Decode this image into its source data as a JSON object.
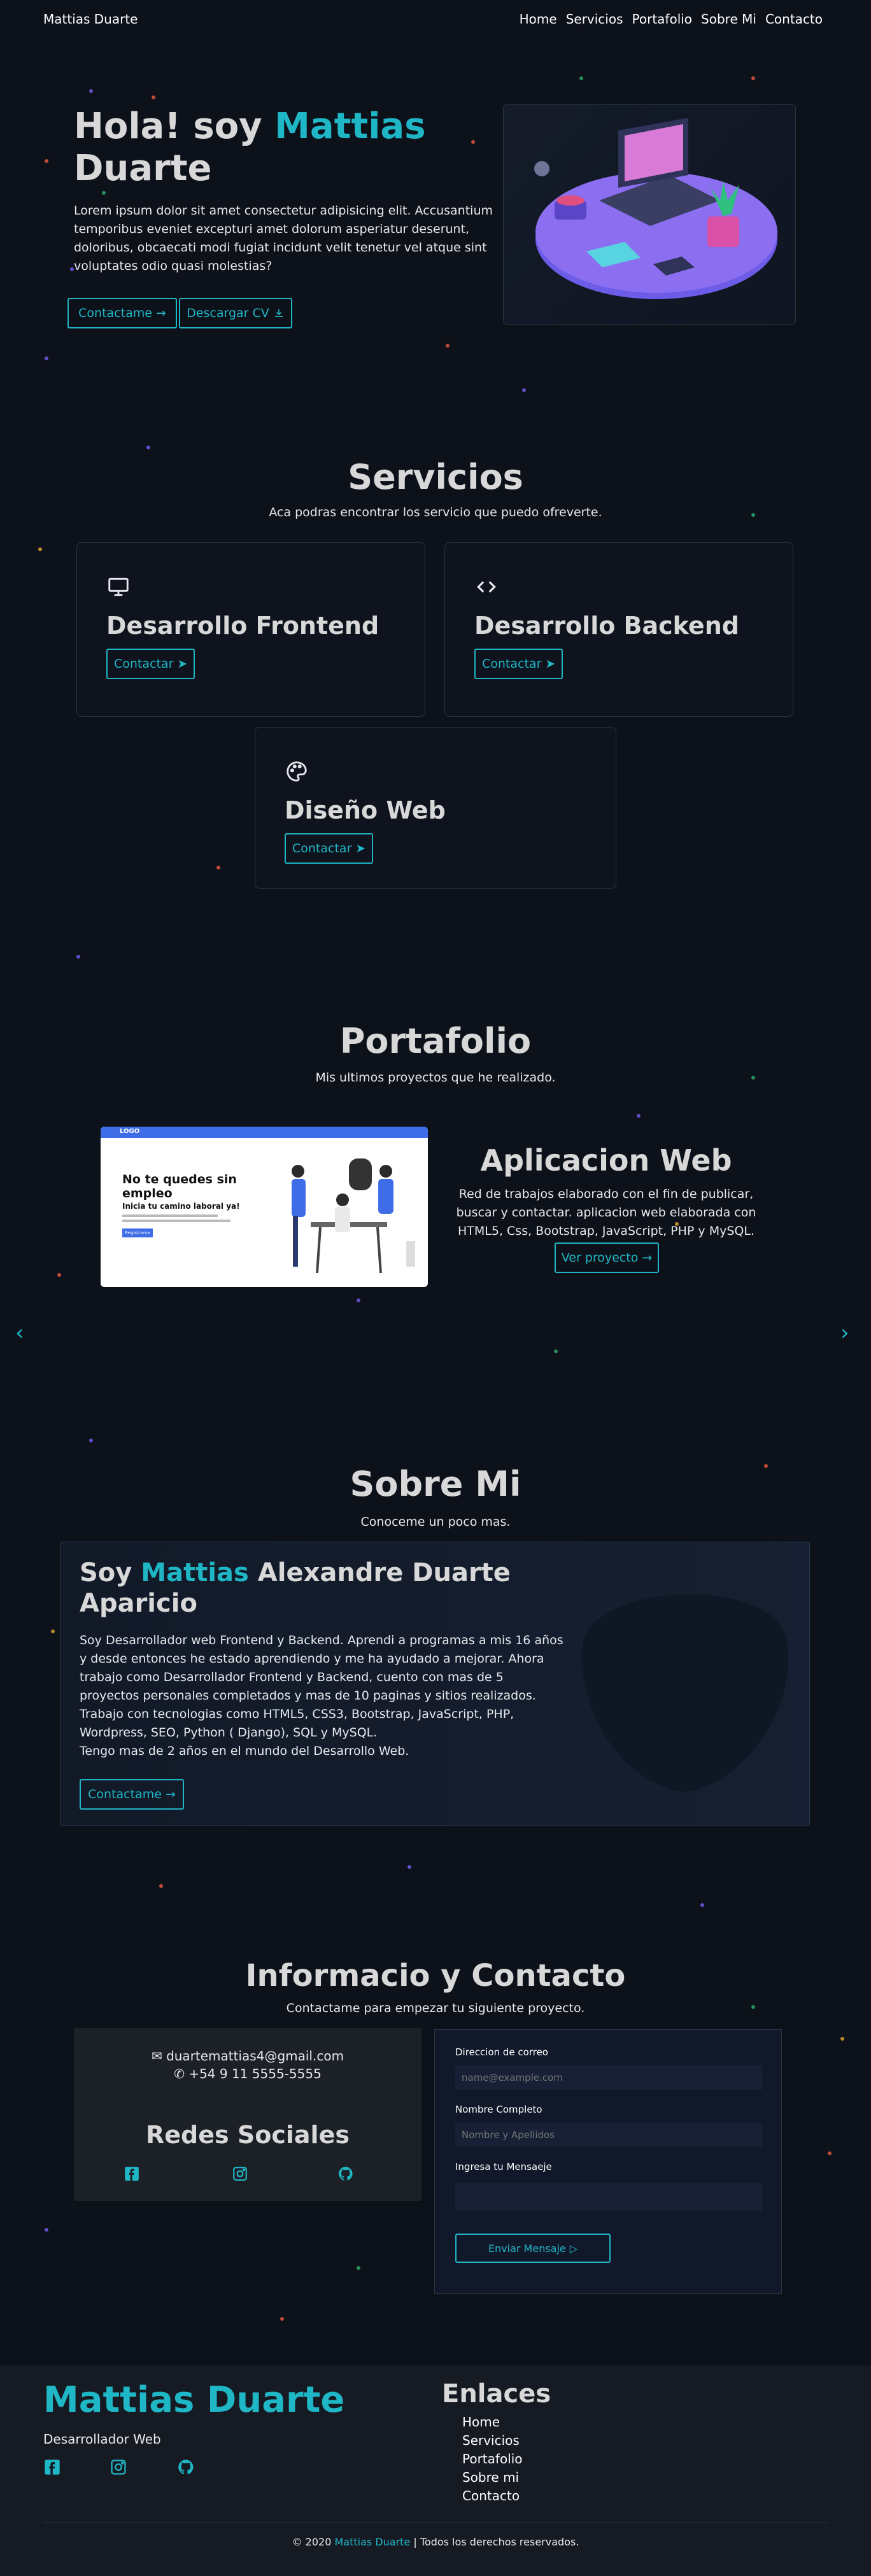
{
  "nav": {
    "brand": "Mattias Duarte",
    "links": [
      "Home",
      "Servicios",
      "Portafolio",
      "Sobre Mi",
      "Contacto"
    ]
  },
  "hero": {
    "title_part1": "Hola! soy ",
    "title_accent": "Mattias",
    "title_part2": "Duarte",
    "text": "Lorem ipsum dolor sit amet consectetur adipisicing elit. Accusantium temporibus eveniet excepturi amet dolorum asperiatur deserunt, doloribus, obcaecati modi fugiat incidunt velit tenetur vel atque sint voluptates odio quasi molestias?",
    "btn_contact": "Contactame",
    "btn_cv": "Descargar CV"
  },
  "services": {
    "title": "Servicios",
    "subtitle": "Aca podras encontrar los servicio que puedo ofreverte.",
    "items": [
      {
        "title": "Desarrollo Frontend",
        "button": "Contactar",
        "icon": "monitor-icon"
      },
      {
        "title": "Desarrollo Backend",
        "button": "Contactar",
        "icon": "code-icon"
      },
      {
        "title": "Diseño Web",
        "button": "Contactar",
        "icon": "palette-icon"
      }
    ]
  },
  "portfolio": {
    "title": "Portafolio",
    "subtitle": "Mis ultimos proyectos que he realizado.",
    "project_title": "Aplicacion Web",
    "project_text": "Red de trabajos elaborado con el fin de publicar, buscar y contactar. aplicacion web elaborada con HTML5, Css, Bootstrap, JavaScript, PHP y MySQL.",
    "project_btn": "Ver proyecto",
    "shot": {
      "logo": "LOGO",
      "headline": "No te quedes sin empleo",
      "subline": "Inicia tu camino laboral ya!",
      "cta": "Registrarse"
    }
  },
  "about": {
    "title": "Sobre Mi",
    "subtitle": "Conoceme un poco mas.",
    "name_prefix": "Soy ",
    "name_accent": "Mattias",
    "name_rest": " Alexandre Duarte Aparicio",
    "text": "Soy Desarrollador web Frontend y Backend. Aprendi a programas a mis 16 años y desde entonces he estado aprendiendo y me ha ayudado a mejorar. Ahora trabajo como Desarrollador Frontend y Backend, cuento con mas de 5 proyectos personales completados y mas de 10 paginas y sitios realizados. Trabajo con tecnologias como HTML5, CSS3, Bootstrap, JavaScript, PHP, Wordpress, SEO, Python ( Django), SQL y MySQL.\nTengo mas de 2 años en el mundo del Desarrollo Web.",
    "button": "Contactame"
  },
  "contact": {
    "title": "Informacio y Contacto",
    "subtitle": "Contactame para empezar tu siguiente proyecto.",
    "email": "duartemattias4@gmail.com",
    "phone": "+54 9 11 5555-5555",
    "social_title": "Redes Sociales",
    "form": {
      "email_label": "Direccion de correo",
      "email_placeholder": "name@example.com",
      "name_label": "Nombre Completo",
      "name_placeholder": "Nombre y Apellidos",
      "message_label": "Ingresa tu Mensaeje",
      "submit": "Enviar Mensaje"
    }
  },
  "footer": {
    "brand": "Mattias Duarte",
    "role": "Desarrollador Web",
    "links_title": "Enlaces",
    "links": [
      "Home",
      "Servicios",
      "Portafolio",
      "Sobre mi",
      "Contacto"
    ],
    "copy_prefix": "© 2020 ",
    "copy_accent": "Mattias Duarte",
    "copy_suffix": " | Todos los derechos reservados."
  },
  "colors": {
    "background": "#0d111a",
    "accent": "#1fb6c5",
    "heading": "#d8d8d8",
    "footer_bg": "#161a22"
  }
}
